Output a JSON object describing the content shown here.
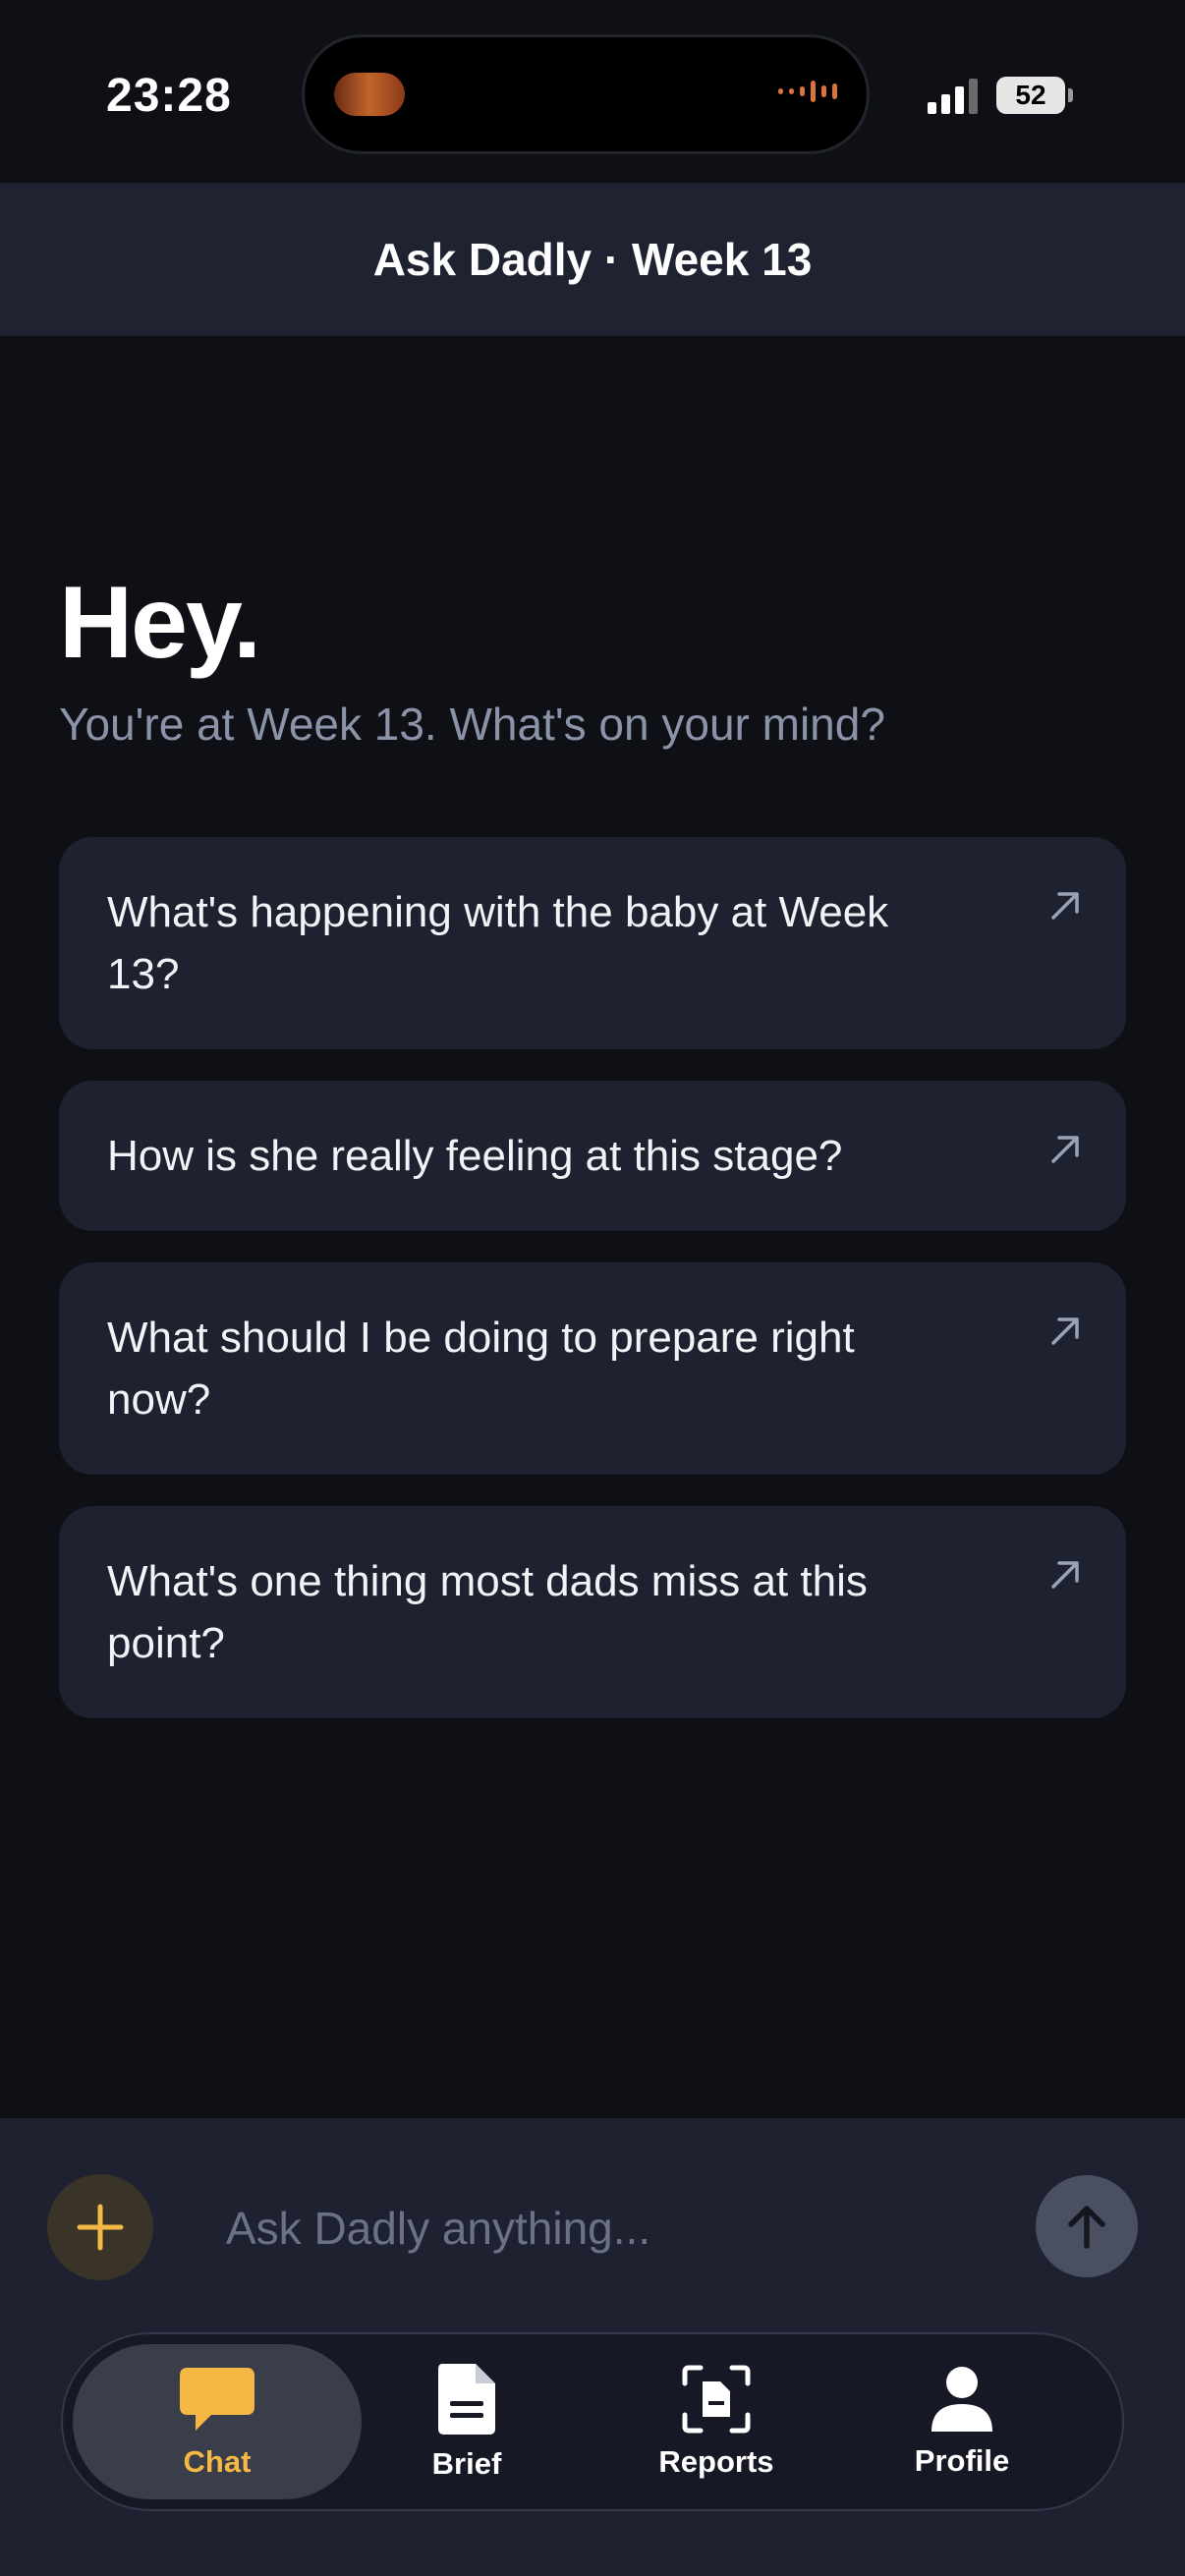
{
  "status_bar": {
    "time": "23:28",
    "battery": "52"
  },
  "header": {
    "title": "Ask Dadly · Week 13"
  },
  "hero": {
    "greeting": "Hey.",
    "subtitle": "You're at Week 13. What's on your mind?"
  },
  "suggestions": [
    {
      "text": "What's happening with the baby at Week 13?"
    },
    {
      "text": "How is she really feeling at this stage?"
    },
    {
      "text": "What should I be doing to prepare right now?"
    },
    {
      "text": "What's one thing most dads miss at this point?"
    }
  ],
  "composer": {
    "placeholder": "Ask Dadly anything..."
  },
  "tabs": [
    {
      "label": "Chat",
      "icon": "chat-bubble-icon",
      "active": true
    },
    {
      "label": "Brief",
      "icon": "document-icon",
      "active": false
    },
    {
      "label": "Reports",
      "icon": "scan-document-icon",
      "active": false
    },
    {
      "label": "Profile",
      "icon": "person-icon",
      "active": false
    }
  ],
  "colors": {
    "accent": "#f5b845",
    "background": "#0e1016",
    "card": "#1e2130"
  }
}
